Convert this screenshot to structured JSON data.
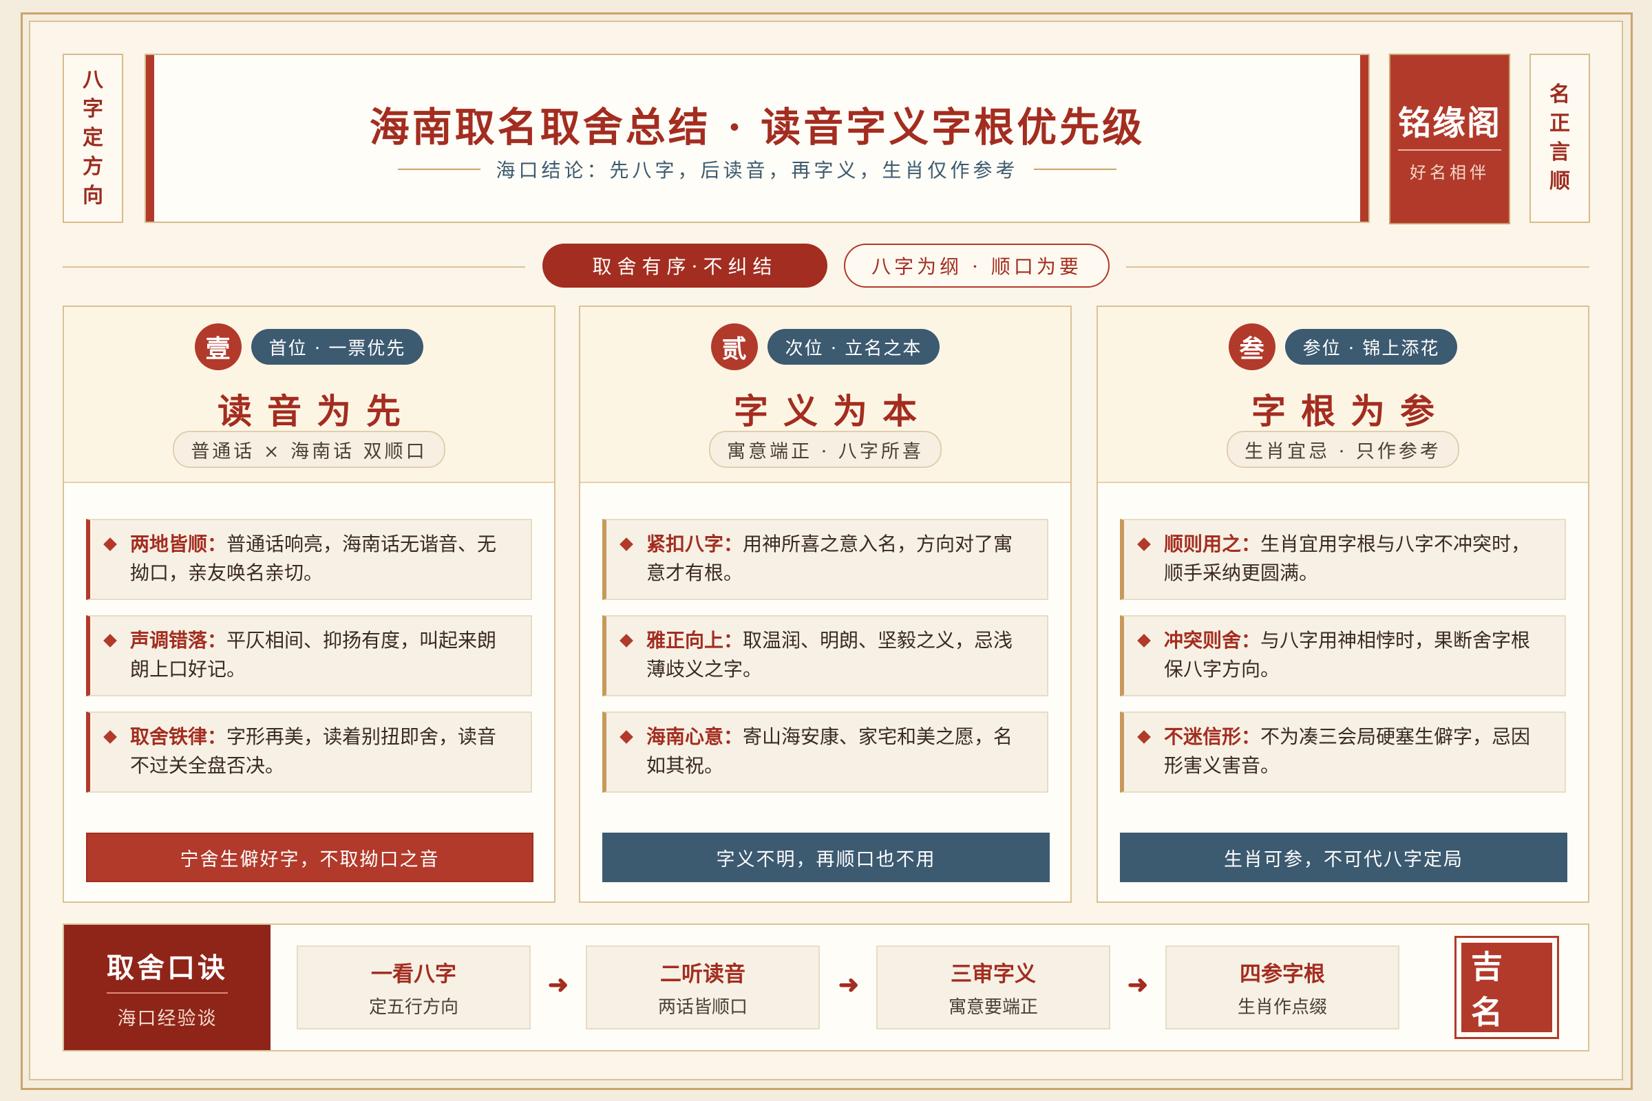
{
  "header": {
    "left_tag": [
      "八",
      "字",
      "定",
      "方",
      "向"
    ],
    "right_tag": [
      "名",
      "正",
      "言",
      "顺"
    ],
    "title": "海南取名取舍总结 · 读音字义字根优先级",
    "subtitle": "海口结论：先八字，后读音，再字义，生肖仅作参考",
    "brand_name": "铭缘阁",
    "brand_sub": "好名相伴"
  },
  "divider": {
    "pill_primary": "取舍有序·不纠结",
    "pill_secondary": "八字为纲 · 顺口为要"
  },
  "cards": [
    {
      "num": "壹",
      "rank": "首位 · 一票优先",
      "title": "读音为先",
      "note": "普通话 × 海南话 双顺口",
      "items": [
        {
          "key": "两地皆顺：",
          "text": "普通话响亮，海南话无谐音、无拗口，亲友唤名亲切。"
        },
        {
          "key": "声调错落：",
          "text": "平仄相间、抑扬有度，叫起来朗朗上口好记。"
        },
        {
          "key": "取舍铁律：",
          "text": "字形再美，读着别扭即舍，读音不过关全盘否决。"
        }
      ],
      "footer": "宁舍生僻好字，不取拗口之音"
    },
    {
      "num": "贰",
      "rank": "次位 · 立名之本",
      "title": "字义为本",
      "note": "寓意端正 · 八字所喜",
      "items": [
        {
          "key": "紧扣八字：",
          "text": "用神所喜之意入名，方向对了寓意才有根。"
        },
        {
          "key": "雅正向上：",
          "text": "取温润、明朗、坚毅之义，忌浅薄歧义之字。"
        },
        {
          "key": "海南心意：",
          "text": "寄山海安康、家宅和美之愿，名如其祝。"
        }
      ],
      "footer": "字义不明，再顺口也不用"
    },
    {
      "num": "叁",
      "rank": "参位 · 锦上添花",
      "title": "字根为参",
      "note": "生肖宜忌 · 只作参考",
      "items": [
        {
          "key": "顺则用之：",
          "text": "生肖宜用字根与八字不冲突时，顺手采纳更圆满。"
        },
        {
          "key": "冲突则舍：",
          "text": "与八字用神相悖时，果断舍字根保八字方向。"
        },
        {
          "key": "不迷信形：",
          "text": "不为凑三会局硬塞生僻字，忌因形害义害音。"
        }
      ],
      "footer": "生肖可参，不可代八字定局"
    }
  ],
  "bottom": {
    "title": "取舍口诀",
    "subtitle": "海口经验谈",
    "steps": [
      {
        "title": "一看八字",
        "sub": "定五行方向"
      },
      {
        "title": "二听读音",
        "sub": "两话皆顺口"
      },
      {
        "title": "三审字义",
        "sub": "寓意要端正"
      },
      {
        "title": "四参字根",
        "sub": "生肖作点缀"
      }
    ],
    "arrow": "➜",
    "seal": "吉名"
  },
  "colors": {
    "accent_red": "#b23a2b",
    "deep_red": "#8f2419",
    "slate_blue": "#3c5a70",
    "gold": "#c9a46b",
    "paper": "#fbf5ea"
  }
}
